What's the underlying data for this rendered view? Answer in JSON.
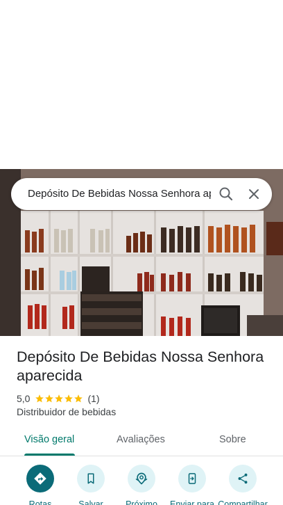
{
  "search": {
    "query": "Depósito De Bebidas Nossa Senhora aparecida"
  },
  "icons": {
    "search": "search-icon",
    "close": "close-icon",
    "directions": "directions-icon",
    "save": "bookmark-icon",
    "nearby": "nearby-icon",
    "send": "send-to-phone-icon",
    "share": "share-icon",
    "star": "star-icon"
  },
  "place": {
    "title": "Depósito De Bebidas Nossa Senhora aparecida",
    "rating": "5,0",
    "stars": 5,
    "review_count": "(1)",
    "category": "Distribuidor de bebidas"
  },
  "tabs": [
    {
      "label": "Visão geral",
      "active": true
    },
    {
      "label": "Avaliações",
      "active": false
    },
    {
      "label": "Sobre",
      "active": false
    }
  ],
  "actions": [
    {
      "label": "Rotas"
    },
    {
      "label": "Salvar"
    },
    {
      "label": "Próximo"
    },
    {
      "label": "Enviar para"
    },
    {
      "label": "Compartilhar"
    }
  ],
  "colors": {
    "accent": "#0b6b78",
    "accent_light": "#dff3f6",
    "tab_active": "#00796b",
    "star": "#fbbc04"
  }
}
